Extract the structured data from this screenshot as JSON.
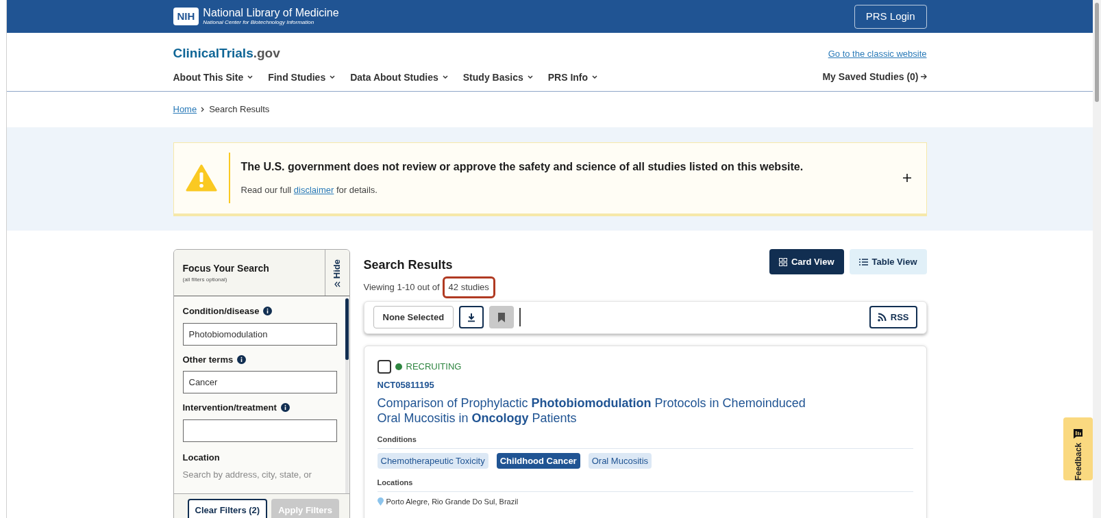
{
  "top_bar": {
    "logo_mark": "NIH",
    "org_name": "National Library of Medicine",
    "org_subtitle": "National Center for Biotechnology Information",
    "login": "PRS Login"
  },
  "site_header": {
    "brand": "ClinicalTrials",
    "brand_suffix": ".gov",
    "classic_link": "Go to the classic website",
    "saved_studies": "My Saved Studies (0)",
    "nav": [
      {
        "label": "About This Site"
      },
      {
        "label": "Find Studies"
      },
      {
        "label": "Data About Studies"
      },
      {
        "label": "Study Basics"
      },
      {
        "label": "PRS Info"
      }
    ]
  },
  "breadcrumb": [
    {
      "label": "Home",
      "link": true
    },
    {
      "label": "Search Results",
      "link": false
    }
  ],
  "alert": {
    "title": "The U.S. government does not review or approve the safety and science of all studies listed on this website.",
    "text_before": "Read our full",
    "link": "disclaimer",
    "text_after": "for details.",
    "expanded": false
  },
  "filters": {
    "title": "Focus Your Search",
    "subtitle": "(all filters optional)",
    "hide": "Hide",
    "fields": [
      {
        "label": "Condition/disease",
        "value": "Photobiomodulation"
      },
      {
        "label": "Other terms",
        "value": "Cancer"
      },
      {
        "label": "Intervention/treatment"
      }
    ],
    "location_label": "Location",
    "location_hint": "Search by address, city, state, or",
    "clear": "Clear Filters (2)",
    "apply": "Apply Filters",
    "apply_disabled": true
  },
  "results": {
    "title": "Search Results",
    "viewing": "Viewing 1-10 out of",
    "count": "42 studies",
    "count_highlighted": true,
    "views": [
      {
        "label": "Card View",
        "kind": "grid",
        "selected": true
      },
      {
        "label": "Table View",
        "kind": "list",
        "selected": false
      }
    ],
    "selection": "None Selected",
    "bookmark_disabled": true,
    "rss": "RSS"
  },
  "studies": [
    {
      "checked": false,
      "status": "RECRUITING",
      "color": "#2e8540",
      "id": "NCT05811195",
      "title_line_1": "Comparison of Prophylactic **Photobiomodulation** Protocols in Chemoinduced",
      "title_line_2": "Oral Mucositis in **Oncology** Patients",
      "conditions_label": "Conditions",
      "conditions": [
        {
          "label": "Chemotherapeutic Toxicity",
          "matched": false
        },
        {
          "label": "Childhood Cancer",
          "matched": true
        },
        {
          "label": "Oral Mucositis",
          "matched": false
        }
      ],
      "locations_label": "Locations",
      "location": "Porto Alegre, Rio Grande Do Sul, Brazil"
    }
  ],
  "feedback": "Feedback"
}
